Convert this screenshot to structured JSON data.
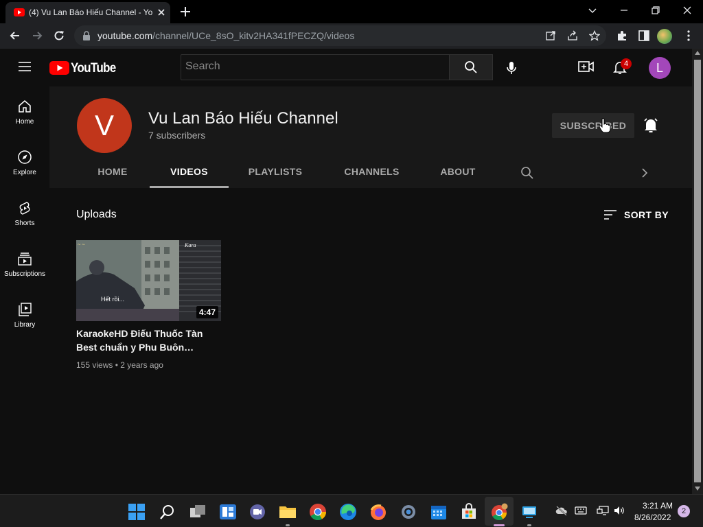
{
  "browser": {
    "tab_title": "(4) Vu Lan Báo Hiếu Channel - Yo",
    "url_host": "youtube.com",
    "url_path": "/channel/UCe_8sO_kitv2HA341fPECZQ/videos",
    "new_tab_icon": "plus-icon"
  },
  "youtube": {
    "logo_text": "YouTube",
    "search_placeholder": "Search",
    "notification_count": "4",
    "user_avatar_letter": "L",
    "brand_red": "#ff0000",
    "sidebar": [
      {
        "label": "Home",
        "icon": "home-icon"
      },
      {
        "label": "Explore",
        "icon": "compass-icon"
      },
      {
        "label": "Shorts",
        "icon": "shorts-icon"
      },
      {
        "label": "Subscriptions",
        "icon": "subscriptions-icon"
      },
      {
        "label": "Library",
        "icon": "library-icon"
      }
    ],
    "channel": {
      "avatar_letter": "V",
      "avatar_color": "#c1361b",
      "name": "Vu Lan Báo Hiếu Channel",
      "subscribers": "7 subscribers",
      "subscribe_label": "SUBSCRIBED",
      "tabs": [
        {
          "label": "HOME",
          "active": false
        },
        {
          "label": "VIDEOS",
          "active": true
        },
        {
          "label": "PLAYLISTS",
          "active": false
        },
        {
          "label": "CHANNELS",
          "active": false
        },
        {
          "label": "ABOUT",
          "active": false
        }
      ]
    },
    "section_title": "Uploads",
    "sort_label": "SORT BY",
    "videos": [
      {
        "duration": "4:47",
        "thumb_caption": "Hết rồi...",
        "thumb_corner_text": "Kara",
        "title": "KaraokeHD Điếu Thuốc Tàn Best chuẩn y Phu Buôn…",
        "meta": "155 views • 2 years ago"
      }
    ]
  },
  "taskbar": {
    "time": "3:21 AM",
    "date": "8/26/2022",
    "notification_count": "2"
  }
}
